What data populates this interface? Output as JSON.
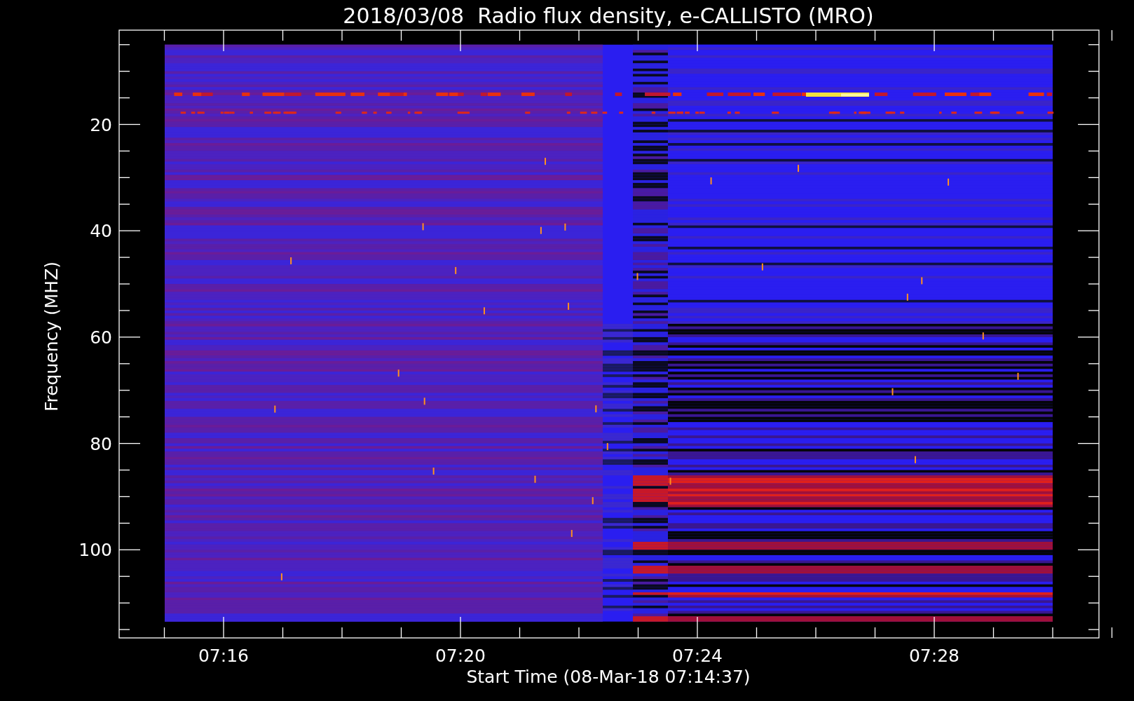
{
  "chart": {
    "title": "2018/03/08  Radio flux density, e-CALLISTO (MRO)",
    "xlabel": "Start Time (08-Mar-18 07:14:37)",
    "ylabel": "Frequency (MHZ)",
    "yticks": [
      "20",
      "40",
      "60",
      "80",
      "100"
    ],
    "xticks": [
      "07:16",
      "07:20",
      "07:24",
      "07:28"
    ]
  }
}
